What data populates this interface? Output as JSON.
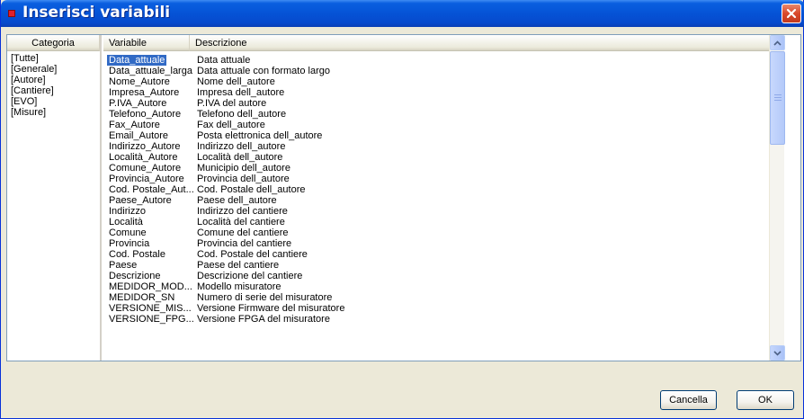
{
  "window": {
    "title": "Inserisci variabili"
  },
  "category_panel": {
    "header": "Categoria",
    "items": [
      "[Tutte]",
      "[Generale]",
      "[Autore]",
      "[Cantiere]",
      "[EVO]",
      "[Misure]"
    ]
  },
  "variable_panel": {
    "columns": {
      "variable": "Variabile",
      "description": "Descrizione"
    },
    "rows": [
      {
        "variable": "Data_attuale",
        "description": "Data attuale"
      },
      {
        "variable": "Data_attuale_larga",
        "description": "Data attuale con formato largo"
      },
      {
        "variable": "Nome_Autore",
        "description": "Nome dell_autore"
      },
      {
        "variable": "Impresa_Autore",
        "description": "Impresa dell_autore"
      },
      {
        "variable": "P.IVA_Autore",
        "description": "P.IVA del autore"
      },
      {
        "variable": "Telefono_Autore",
        "description": "Telefono dell_autore"
      },
      {
        "variable": "Fax_Autore",
        "description": "Fax dell_autore"
      },
      {
        "variable": "Email_Autore",
        "description": "Posta elettronica dell_autore"
      },
      {
        "variable": "Indirizzo_Autore",
        "description": "Indirizzo dell_autore"
      },
      {
        "variable": "Località_Autore",
        "description": "Località dell_autore"
      },
      {
        "variable": "Comune_Autore",
        "description": "Municipio dell_autore"
      },
      {
        "variable": "Provincia_Autore",
        "description": "Provincia dell_autore"
      },
      {
        "variable": "Cod. Postale_Aut...",
        "description": "Cod. Postale dell_autore"
      },
      {
        "variable": "Paese_Autore",
        "description": "Paese dell_autore"
      },
      {
        "variable": "Indirizzo",
        "description": "Indirizzo del cantiere"
      },
      {
        "variable": "Località",
        "description": "Località del cantiere"
      },
      {
        "variable": "Comune",
        "description": "Comune del cantiere"
      },
      {
        "variable": "Provincia",
        "description": "Provincia del cantiere"
      },
      {
        "variable": "Cod. Postale",
        "description": "Cod. Postale del cantiere"
      },
      {
        "variable": "Paese",
        "description": "Paese del cantiere"
      },
      {
        "variable": "Descrizione",
        "description": "Descrizione del cantiere"
      },
      {
        "variable": "MEDIDOR_MOD...",
        "description": "Modello misuratore"
      },
      {
        "variable": "MEDIDOR_SN",
        "description": "Numero di serie del misuratore"
      },
      {
        "variable": "VERSIONE_MIS...",
        "description": "Versione Firmware del misuratore"
      },
      {
        "variable": "VERSIONE_FPG...",
        "description": "Versione FPGA del misuratore"
      }
    ],
    "selected_index": 0
  },
  "buttons": {
    "cancel": "Cancella",
    "ok": "OK"
  },
  "icons": {
    "app": "app-icon",
    "close": "close-icon",
    "scroll_up": "chevron-up-icon",
    "scroll_down": "chevron-down-icon"
  },
  "colors": {
    "titlebar": "#0553d6",
    "selection": "#316ac5",
    "close": "#d9482b",
    "dialog_bg": "#ece9d8"
  }
}
